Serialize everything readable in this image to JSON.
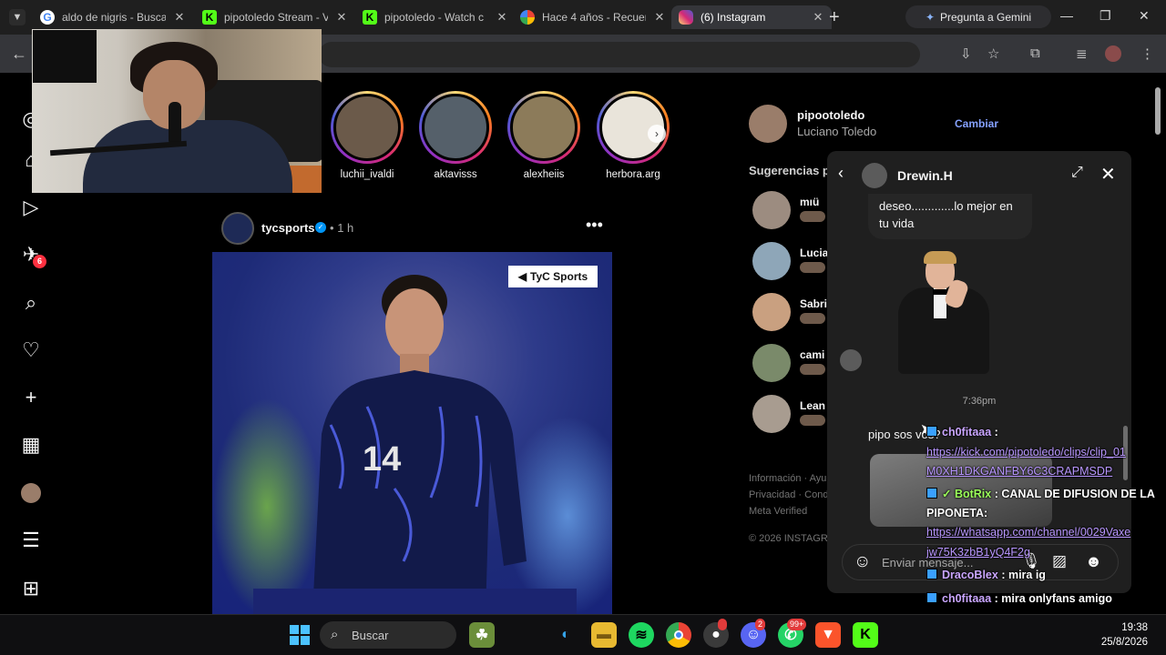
{
  "browser": {
    "tabs": [
      {
        "title": "aldo de nigris - Buscar",
        "active": false,
        "favicon_color": "#4285f4"
      },
      {
        "title": "pipotoledo Stream - V",
        "active": false,
        "favicon_color": "#53fc18"
      },
      {
        "title": "pipotoledo - Watch c",
        "active": false,
        "favicon_color": "#53fc18"
      },
      {
        "title": "Hace 4 años - Recuer",
        "active": false,
        "favicon_color": "#fbbc05"
      },
      {
        "title": "(6) Instagram",
        "active": true,
        "favicon_color": "#d62976"
      }
    ],
    "gemini_label": "Pregunta a Gemini"
  },
  "instagram": {
    "notification_count": "6",
    "stories": [
      {
        "name": "luchii_ivaldi",
        "color": "#6b5a4a"
      },
      {
        "name": "aktavisss",
        "color": "#55606a"
      },
      {
        "name": "alexheiis",
        "color": "#8c7b5a"
      },
      {
        "name": "herbora.arg",
        "color": "#e9e4da"
      }
    ],
    "post": {
      "username": "tycsports",
      "separator": "•",
      "time": "1 h",
      "watermark": "TyC Sports",
      "jersey_number": "14"
    },
    "profile": {
      "username": "pipootoledo",
      "name": "Luciano Toledo",
      "switch_label": "Cambiar"
    },
    "suggestions_title": "Sugerencias pa",
    "suggestions": [
      {
        "name": "mıü",
        "color": "#9c8c80"
      },
      {
        "name": "Lucia",
        "color": "#8ea6b8"
      },
      {
        "name": "Sabri",
        "color": "#c9a080"
      },
      {
        "name": "cami",
        "color": "#7a8a6a"
      },
      {
        "name": "Lean",
        "color": "#a89c90"
      }
    ],
    "footer_lines": [
      "Información · Ayu",
      "Privacidad · Cond",
      "Meta Verified"
    ],
    "copyright": "© 2026 INSTAGR"
  },
  "dm": {
    "contact": "Drewin.H",
    "message_top": "deseo.............lo mejor en tu vida",
    "timestamp": "7:36pm",
    "message_reply": "pipo sos vos?",
    "input_placeholder": "Enviar mensaje..."
  },
  "chat_overlay": [
    {
      "user": "ch0fitaaa",
      "text": " :",
      "class": "u1"
    },
    {
      "user": "",
      "text": "https://kick.com/pipotoledo/clips/clip_01",
      "class": "lnk"
    },
    {
      "user": "",
      "text": "M0XH1DKGANFBY6C3CRAPMSDP",
      "class": "lnk"
    },
    {
      "user": "BotRix",
      "text": " : CANAL DE DIFUSION DE LA",
      "class": "u2"
    },
    {
      "user": "",
      "text": "PIPONETA:",
      "class": ""
    },
    {
      "user": "",
      "text": "https://whatsapp.com/channel/0029Vaxe",
      "class": "lnk"
    },
    {
      "user": "",
      "text": "jw75K3zbB1yQ4F2g",
      "class": "lnk"
    },
    {
      "user": "DracoBlex",
      "text": " : mira ig",
      "class": "u1"
    },
    {
      "user": "ch0fitaaa",
      "text": " : mira onlyfans amigo",
      "class": "u1"
    }
  ],
  "taskbar": {
    "search_placeholder": "Buscar",
    "discord_badge": "2",
    "whatsapp_badge": "99+",
    "time": "19:38",
    "date": "25/8/2026"
  },
  "icons": {
    "nav": [
      "instagram-icon",
      "home-icon",
      "reels-icon",
      "notifications-icon",
      "search-icon",
      "heart-icon",
      "create-icon",
      "dashboard-icon",
      "profile-avatar",
      "menu-icon",
      "threads-icon"
    ]
  }
}
